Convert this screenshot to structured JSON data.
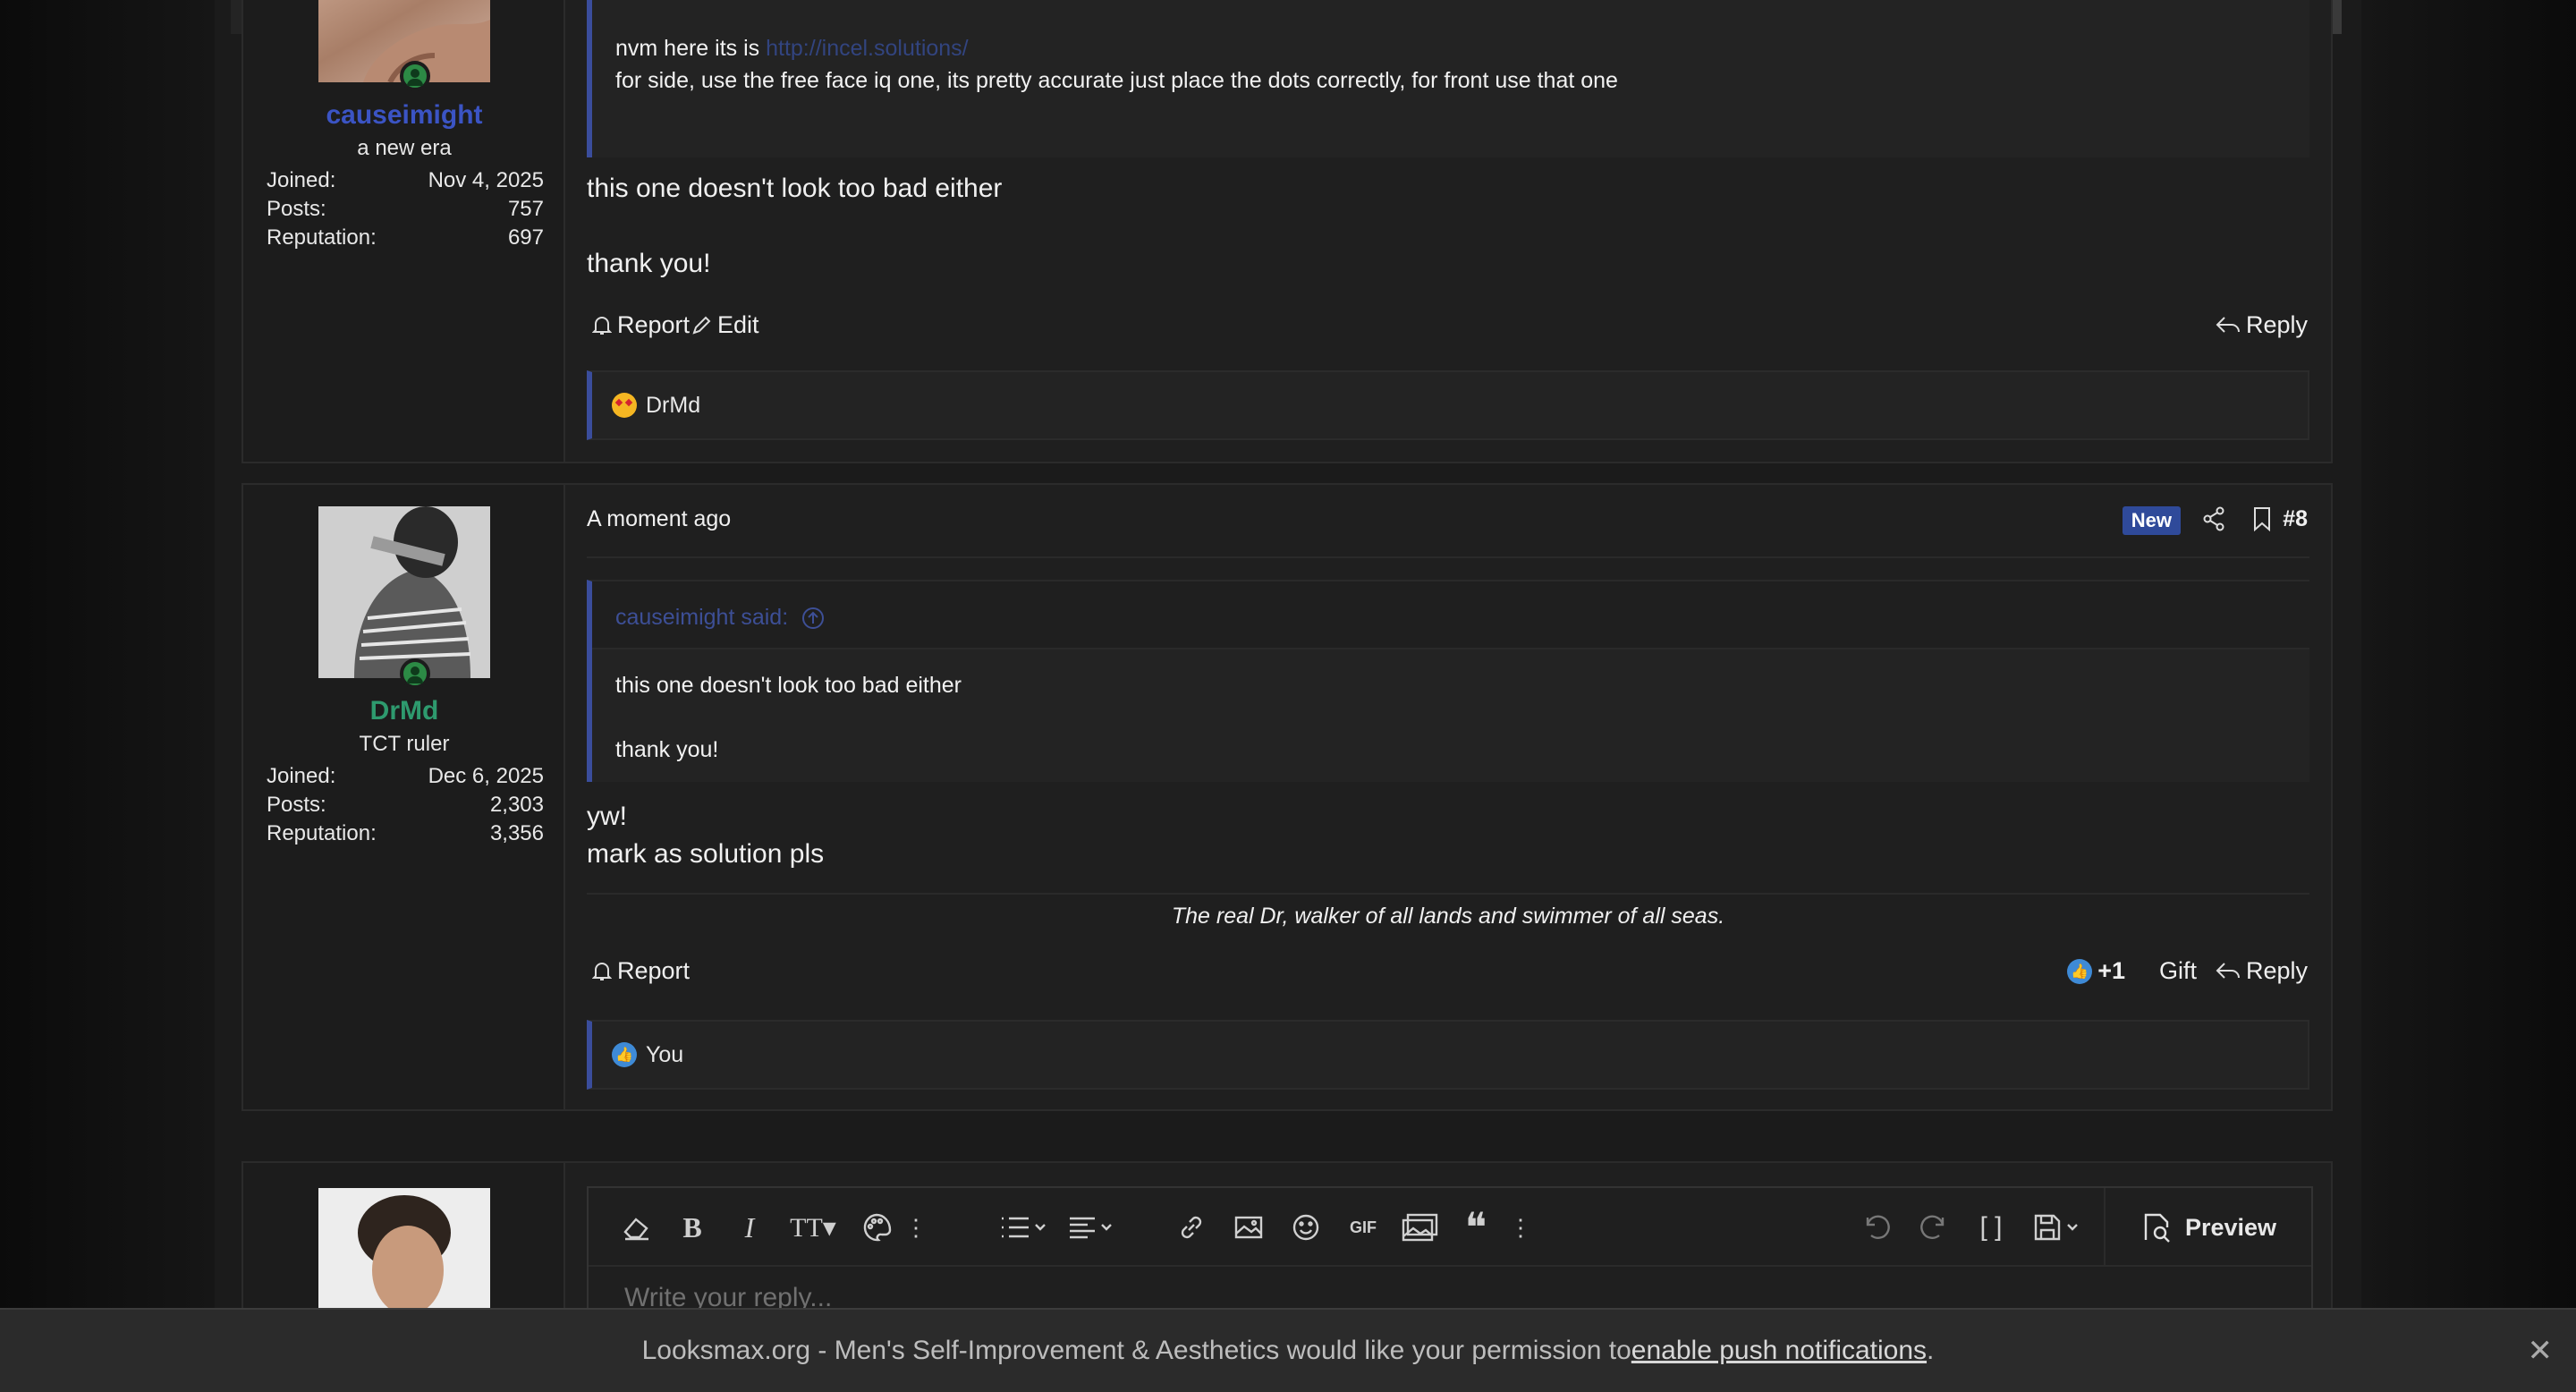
{
  "post1": {
    "username": "causeimight",
    "user_title": "a new era",
    "stats": [
      {
        "label": "Joined:",
        "value": "Nov 4, 2025"
      },
      {
        "label": "Posts:",
        "value": "757"
      },
      {
        "label": "Reputation:",
        "value": "697"
      }
    ],
    "quote_line1_prefix": "nvm here its is ",
    "quote_link": "http://incel.solutions/",
    "quote_line2": "for side, use the free face iq one, its pretty accurate just place the dots correctly, for front use that one",
    "body_line1": "this one doesn't look too bad either",
    "body_line2": "thank you!",
    "action_report": "Report",
    "action_edit": "Edit",
    "action_reply": "Reply",
    "reaction_user": "DrMd"
  },
  "post2": {
    "timestamp": "A moment ago",
    "badge": "New",
    "post_number": "#8",
    "username": "DrMd",
    "user_title": "TCT ruler",
    "stats": [
      {
        "label": "Joined:",
        "value": "Dec 6, 2025"
      },
      {
        "label": "Posts:",
        "value": "2,303"
      },
      {
        "label": "Reputation:",
        "value": "3,356"
      }
    ],
    "quote_head": "causeimight said:",
    "quote_line1": "this one doesn't look too bad either",
    "quote_line2": "thank you!",
    "body_line1": "yw!",
    "body_line2": "mark as solution pls",
    "signature": "The real Dr, walker of all lands and swimmer of all seas.",
    "action_report": "Report",
    "like_count": "+1",
    "action_gift": "Gift",
    "action_reply": "Reply",
    "reaction_user": "You"
  },
  "editor": {
    "placeholder": "Write your reply...",
    "preview_label": "Preview"
  },
  "notice": {
    "text_before": "Looksmax.org - Men's Self-Improvement & Aesthetics would like your permission to ",
    "link_text": "enable push notifications",
    "text_after": "."
  },
  "colors": {
    "username_post1": "#3b54c4",
    "username_post2": "#2e9a6e",
    "quote_accent": "#3a4d9c",
    "new_badge": "#2f4a9a"
  }
}
